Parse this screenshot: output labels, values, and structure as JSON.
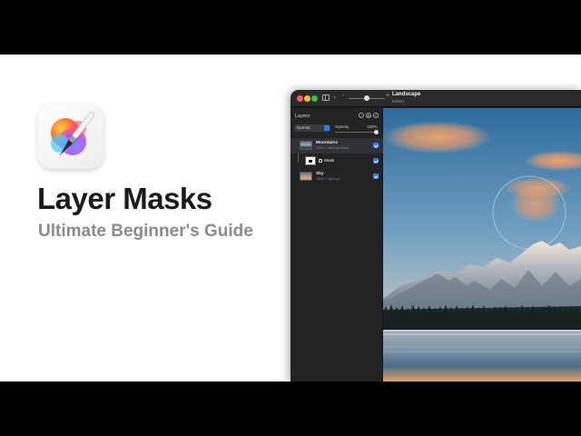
{
  "hero": {
    "title": "Layer Masks",
    "subtitle": "Ultimate Beginner's Guide",
    "app_icon": "pixelmator-pro-icon"
  },
  "window": {
    "document_title": "Landscape",
    "document_status": "Edited",
    "toolbar": {
      "zoom_out": "-",
      "zoom_in": "+",
      "chevron": "⌄"
    }
  },
  "layers_panel": {
    "title": "Layers",
    "blend_mode": "Normal",
    "opacity_label": "Opacity",
    "opacity_value": "100%",
    "opacity_fraction": 1.0,
    "layers": [
      {
        "name": "Mountains",
        "dims": "2300 × 1603 px",
        "badge": "Mask",
        "selected": true,
        "visible": true
      },
      {
        "name": "Mask",
        "type": "mask",
        "visible": true
      },
      {
        "name": "Sky",
        "dims": "2300 × 1603 px",
        "selected": false,
        "visible": true
      }
    ]
  },
  "colors": {
    "accent": "#2f7df6",
    "panel_bg": "#232326",
    "window_bg": "#1e1e20",
    "headline": "#1b1b1d",
    "subline": "#8a8a8f"
  }
}
